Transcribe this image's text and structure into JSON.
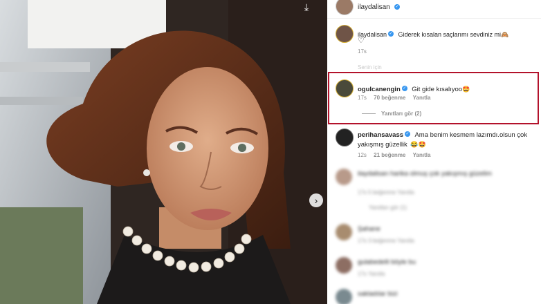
{
  "post": {
    "author": "ilaydalisan",
    "caption_author": "ilaydalisan",
    "caption_text": "Giderek kısalan saçlarımı sevdiniz mi",
    "caption_time": "17s",
    "faded_text": "Senin için"
  },
  "comments": [
    {
      "username": "ogulcanengin",
      "text": "Git gide kısalıyoo",
      "time": "17s",
      "likes": "70 beğenme",
      "reply": "Yanıtla",
      "view_replies": "Yanıtları gör (2)"
    },
    {
      "username": "perihansavass",
      "text_line1": "Ama benim kesmem lazımdı.olsun çok",
      "text_line2": "yakışmış güzellik",
      "time": "12s",
      "likes": "21 beğenme",
      "reply": "Yanıtla"
    },
    {
      "text": "ilaydalisan harika olmuş çok yakışmış güzelim",
      "meta": "17s   5 beğenme   Yanıtla",
      "replies": "Yanıtları gör (1)"
    },
    {
      "text": "Şahane",
      "meta": "17s   3 beğenme   Yanıtla"
    },
    {
      "text": "gulabedelli böyle bu",
      "meta": "17s   Yanıtla"
    },
    {
      "text": "sakladılar bizi",
      "meta": "17s   Yanıtla"
    }
  ],
  "icons": {
    "download": "download-icon",
    "next": "chevron-right-icon",
    "heart": "heart-icon",
    "verified": "verified-badge-icon"
  },
  "colors": {
    "highlight": "#b3122b",
    "verified": "#3897f0"
  }
}
